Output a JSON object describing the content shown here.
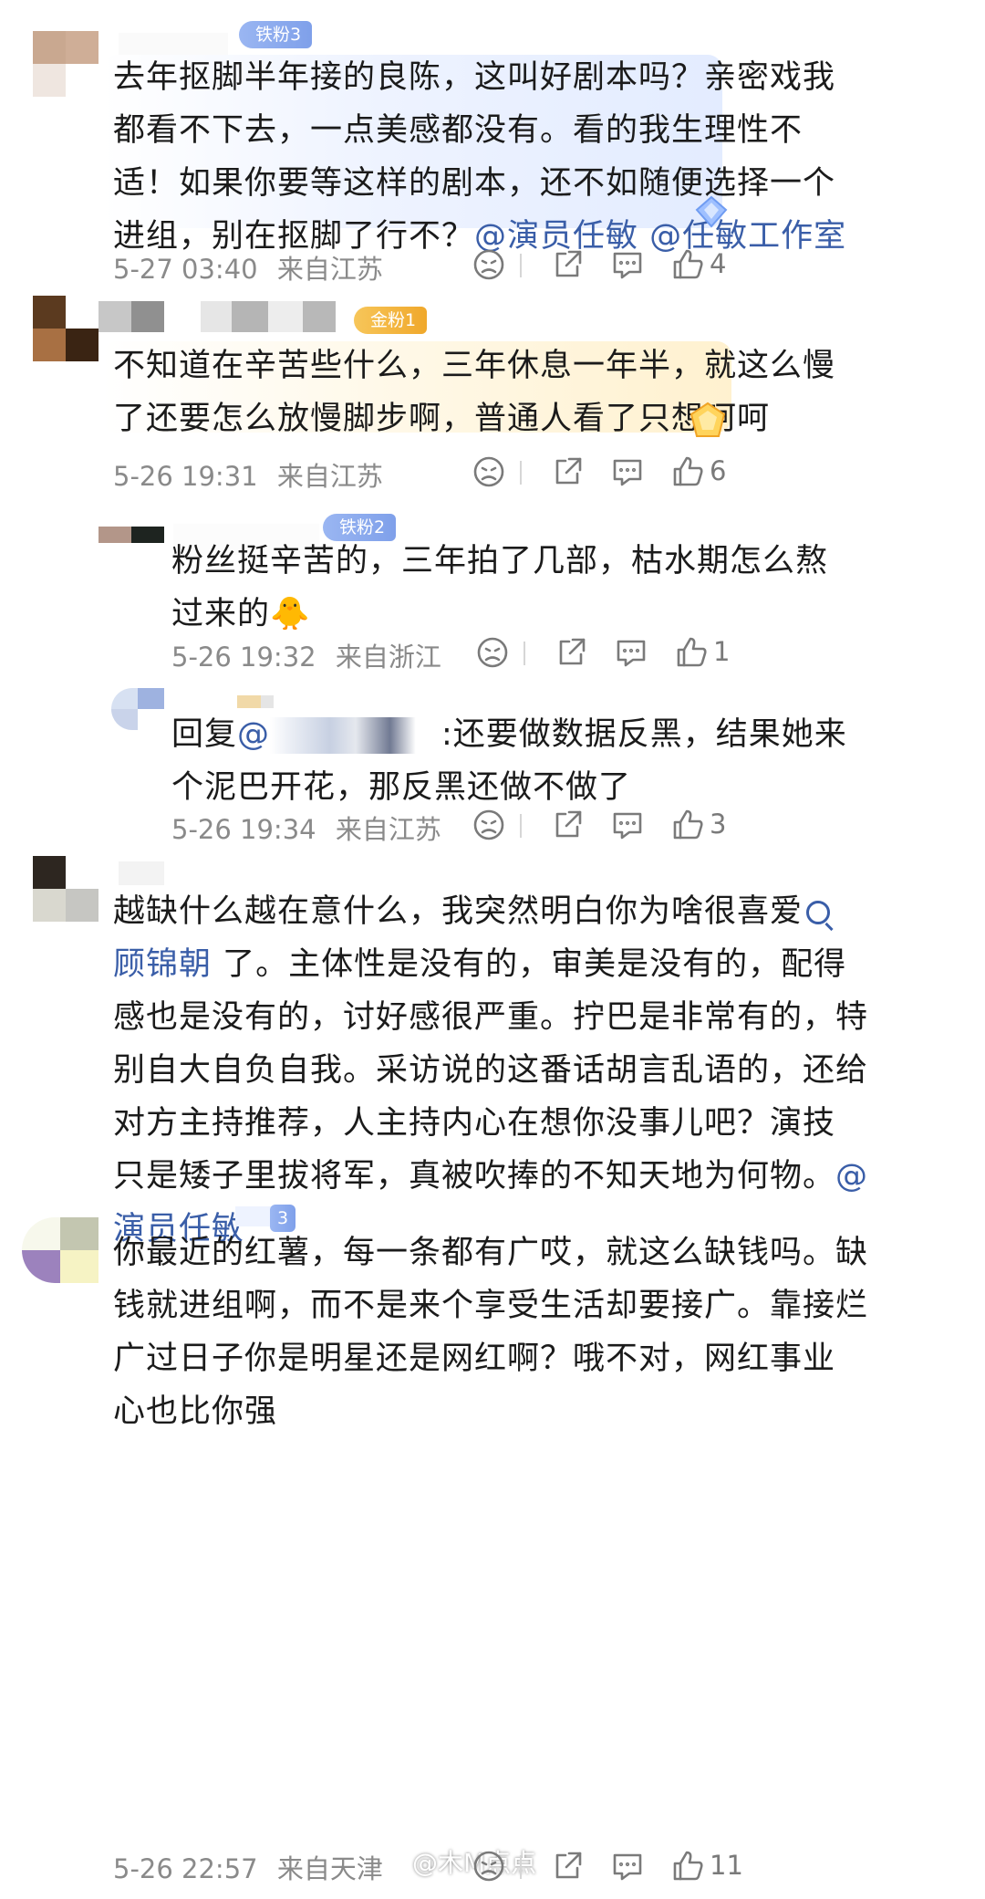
{
  "comments": [
    {
      "badge": "铁粉3",
      "lines": [
        "去年抠脚半年接的良陈，这叫好剧本吗？亲密戏我",
        "都看不下去，一点美感都没有。看的我生理性不",
        "适！如果你要等这样的剧本，还不如随便选择一个",
        "进组，别在抠脚了行不？"
      ],
      "mentions": [
        "@演员任敏",
        "@任敏工作室"
      ],
      "time": "5-27 03:40",
      "location": "来自江苏",
      "likes": "4"
    },
    {
      "badge": "金粉1",
      "lines": [
        "不知道在辛苦些什么，三年休息一年半，就这么慢",
        "了还要怎么放慢脚步啊，普通人看了只想呵呵"
      ],
      "time": "5-26 19:31",
      "location": "来自江苏",
      "likes": "6"
    },
    {
      "badge": "铁粉2",
      "lines": [
        "粉丝挺辛苦的，三年拍了几部，枯水期怎么熬",
        "过来的"
      ],
      "emoji": "🐥",
      "time": "5-26 19:32",
      "location": "来自浙江",
      "likes": "1"
    },
    {
      "reply_prefix": "回复",
      "reply_at": "@",
      "reply_mid": ":还要做数据反黑，结果她来",
      "lines": [
        "个泥巴开花，那反黑还做不做了"
      ],
      "time": "5-26 19:34",
      "location": "来自江苏",
      "likes": "3"
    },
    {
      "line1": "越缺什么越在意什么，我突然明白你为啥很喜爱",
      "topic": "顾锦朝",
      "line2_rest": " 了。主体性是没有的，审美是没有的，配得",
      "lines": [
        "感也是没有的，讨好感很严重。拧巴是非常有的，特",
        "别自大自负自我。采访说的这番话胡言乱语的，还给",
        "对方主持推荐，人主持内心在想你没事儿吧？演技",
        "只是矮子里拔将军，真被吹捧的不知天地为何物。"
      ],
      "mention_tail": "@",
      "mention_last": "演员任敏"
    },
    {
      "badge": "3",
      "lines": [
        "你最近的红薯，每一条都有广哎，就这么缺钱吗。缺",
        "钱就进组啊，而不是来个享受生活却要接广。靠接烂",
        "广过日子你是明星还是网红啊？哦不对，网红事业",
        "心也比你强"
      ],
      "time": "5-26 22:57",
      "location": "来自天津",
      "likes": "11"
    }
  ],
  "watermark": "@木M点点",
  "colors": {
    "mention": "#3a5ea8",
    "meta": "#8a8a8a",
    "icon": "#7a7a7a"
  }
}
